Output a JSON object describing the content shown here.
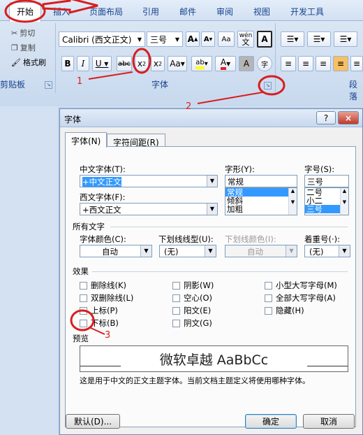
{
  "ribbon": {
    "tabs": [
      "开始",
      "插入",
      "页面布局",
      "引用",
      "邮件",
      "审阅",
      "视图",
      "开发工具"
    ],
    "clipboard": {
      "cut": "剪切",
      "copy": "复制",
      "format_painter": "格式刷",
      "group_label": "剪贴板"
    },
    "font": {
      "font_name": "Calibri (西文正文)",
      "font_size": "三号",
      "group_label": "字体",
      "phonetic": "wén",
      "char_border": "A"
    },
    "paragraph": {
      "group_label": "段落"
    }
  },
  "dialog": {
    "title": "字体",
    "help": "?",
    "close": "×",
    "tabs": [
      "字体(N)",
      "字符间距(R)"
    ],
    "chinese_font": {
      "label": "中文字体(T):",
      "value": "+中文正文"
    },
    "western_font": {
      "label": "西文字体(F):",
      "value": "+西文正文"
    },
    "style": {
      "label": "字形(Y):",
      "value": "常规",
      "options": [
        "常规",
        "倾斜",
        "加粗"
      ],
      "selected": "常规"
    },
    "size": {
      "label": "字号(S):",
      "value": "三号",
      "options": [
        "二号",
        "小二",
        "三号"
      ],
      "selected": "三号"
    },
    "all_text": {
      "section": "所有文字",
      "font_color": {
        "label": "字体颜色(C):",
        "value": "自动"
      },
      "underline_type": {
        "label": "下划线线型(U):",
        "value": "(无)"
      },
      "underline_color": {
        "label": "下划线颜色(I):",
        "value": "自动"
      },
      "emphasis": {
        "label": "着重号(·):",
        "value": "(无)"
      }
    },
    "effects": {
      "section": "效果",
      "items": [
        {
          "label": "删除线(K)",
          "checked": false
        },
        {
          "label": "阴影(W)",
          "checked": false
        },
        {
          "label": "小型大写字母(M)",
          "checked": false
        },
        {
          "label": "双删除线(L)",
          "checked": false
        },
        {
          "label": "空心(O)",
          "checked": false
        },
        {
          "label": "全部大写字母(A)",
          "checked": false
        },
        {
          "label": "上标(P)",
          "checked": false
        },
        {
          "label": "阳文(E)",
          "checked": false
        },
        {
          "label": "隐藏(H)",
          "checked": false
        },
        {
          "label": "下标(B)",
          "checked": false
        },
        {
          "label": "阴文(G)",
          "checked": false
        }
      ]
    },
    "preview": {
      "section": "预览",
      "text": "微软卓越  AaBbCc",
      "note": "这是用于中文的正文主题字体。当前文档主题定义将使用哪种字体。"
    },
    "buttons": {
      "default": "默认(D)...",
      "ok": "确定",
      "cancel": "取消"
    }
  },
  "annotations": [
    "1",
    "2",
    "3"
  ],
  "colors": {
    "annotation": "#d81e1e",
    "selection": "#3399ff",
    "ribbon_text": "#15428b"
  }
}
